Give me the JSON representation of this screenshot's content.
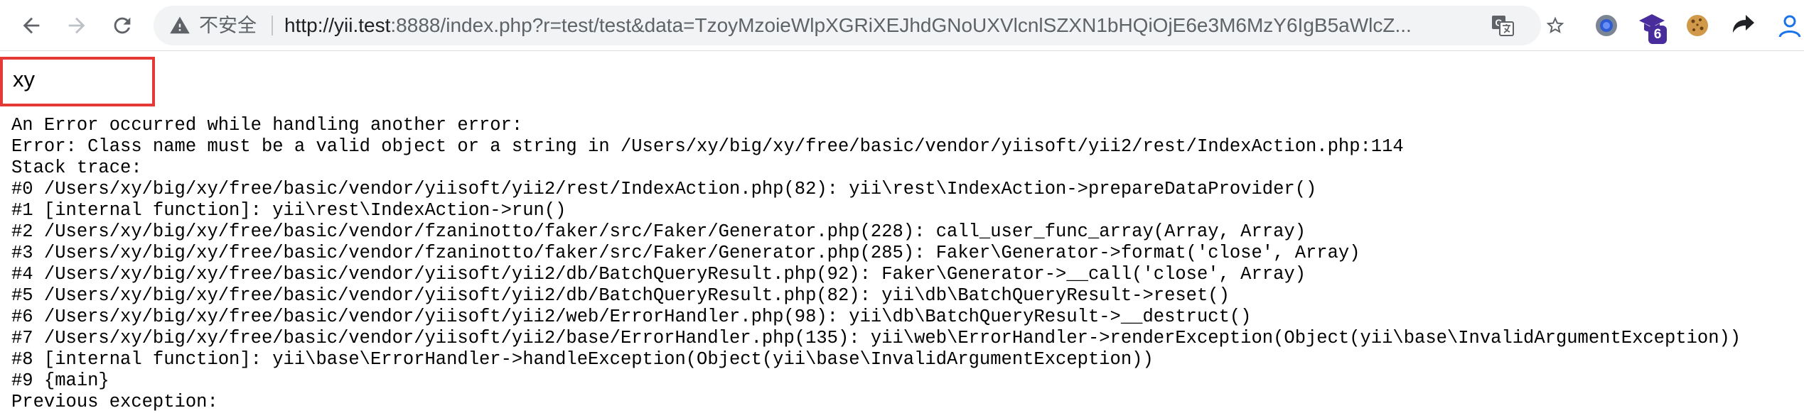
{
  "browser": {
    "security_label": "不安全",
    "url_host": "http://yii.test",
    "url_rest": ":8888/index.php?r=test/test&data=TzoyMzoieWlpXGRiXEJhdGNoUXVlcnlSZXN1bHQiOjE6e3M6MzY6IgB5aWlcZ...",
    "extension_badge": "6",
    "icons": [
      "back-icon",
      "forward-icon",
      "reload-icon",
      "warning-icon",
      "translate-icon",
      "star-icon",
      "extension-icon"
    ]
  },
  "page": {
    "input_text": "xy",
    "highlight_color": "#e53935",
    "error_lines": [
      "An Error occurred while handling another error:",
      "Error: Class name must be a valid object or a string in /Users/xy/big/xy/free/basic/vendor/yiisoft/yii2/rest/IndexAction.php:114",
      "Stack trace:",
      "#0 /Users/xy/big/xy/free/basic/vendor/yiisoft/yii2/rest/IndexAction.php(82): yii\\rest\\IndexAction->prepareDataProvider()",
      "#1 [internal function]: yii\\rest\\IndexAction->run()",
      "#2 /Users/xy/big/xy/free/basic/vendor/fzaninotto/faker/src/Faker/Generator.php(228): call_user_func_array(Array, Array)",
      "#3 /Users/xy/big/xy/free/basic/vendor/fzaninotto/faker/src/Faker/Generator.php(285): Faker\\Generator->format('close', Array)",
      "#4 /Users/xy/big/xy/free/basic/vendor/yiisoft/yii2/db/BatchQueryResult.php(92): Faker\\Generator->__call('close', Array)",
      "#5 /Users/xy/big/xy/free/basic/vendor/yiisoft/yii2/db/BatchQueryResult.php(82): yii\\db\\BatchQueryResult->reset()",
      "#6 /Users/xy/big/xy/free/basic/vendor/yiisoft/yii2/web/ErrorHandler.php(98): yii\\db\\BatchQueryResult->__destruct()",
      "#7 /Users/xy/big/xy/free/basic/vendor/yiisoft/yii2/base/ErrorHandler.php(135): yii\\web\\ErrorHandler->renderException(Object(yii\\base\\InvalidArgumentException))",
      "#8 [internal function]: yii\\base\\ErrorHandler->handleException(Object(yii\\base\\InvalidArgumentException))",
      "#9 {main}",
      "Previous exception:"
    ]
  }
}
